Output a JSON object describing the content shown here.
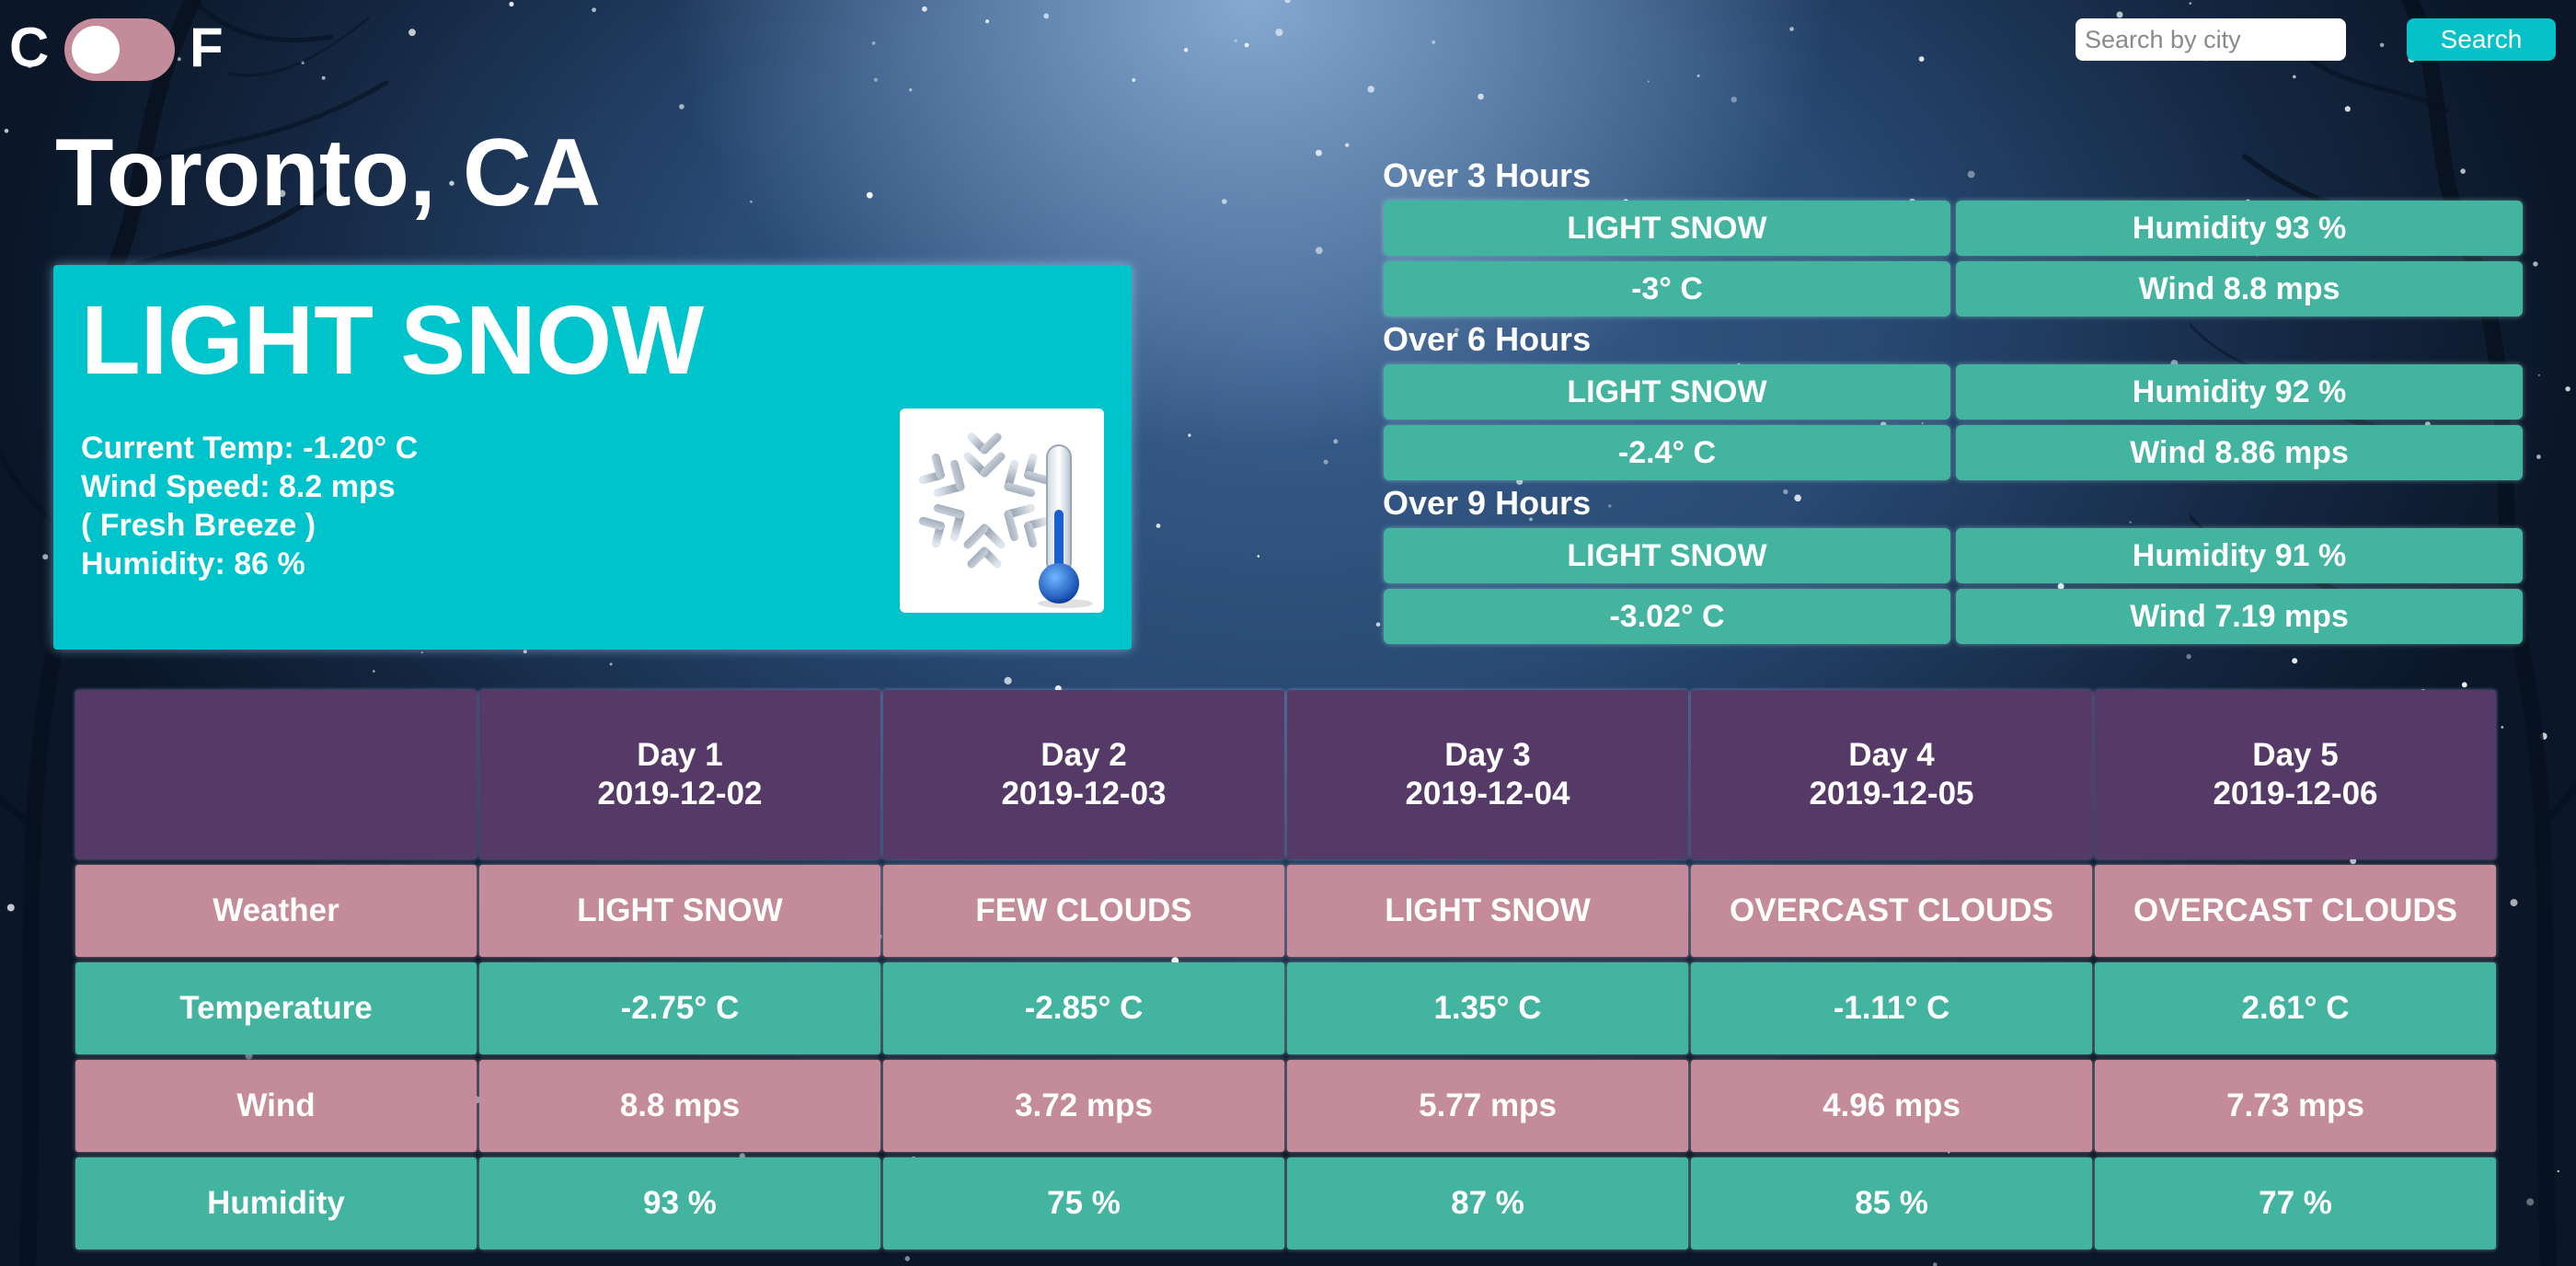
{
  "units": {
    "celsius": "C",
    "fahrenheit": "F"
  },
  "search": {
    "placeholder": "Search by city",
    "button_label": "Search",
    "value": ""
  },
  "city": "Toronto, CA",
  "current": {
    "description": "LIGHT SNOW",
    "temp": "Current Temp: -1.20° C",
    "wind": "Wind Speed: 8.2 mps",
    "wind_desc": "( Fresh Breeze )",
    "humidity": "Humidity: 86 %",
    "icon": "snowflake-thermometer-icon"
  },
  "hourly": [
    {
      "title": "Over 3 Hours",
      "description": "LIGHT SNOW",
      "humidity": "Humidity 93 %",
      "temp": "-3° C",
      "wind": "Wind 8.8 mps"
    },
    {
      "title": "Over 6 Hours",
      "description": "LIGHT SNOW",
      "humidity": "Humidity 92 %",
      "temp": "-2.4° C",
      "wind": "Wind 8.86 mps"
    },
    {
      "title": "Over 9 Hours",
      "description": "LIGHT SNOW",
      "humidity": "Humidity 91 %",
      "temp": "-3.02° C",
      "wind": "Wind 7.19 mps"
    }
  ],
  "forecast": {
    "days": [
      {
        "label": "Day 1",
        "date": "2019-12-02"
      },
      {
        "label": "Day 2",
        "date": "2019-12-03"
      },
      {
        "label": "Day 3",
        "date": "2019-12-04"
      },
      {
        "label": "Day 4",
        "date": "2019-12-05"
      },
      {
        "label": "Day 5",
        "date": "2019-12-06"
      }
    ],
    "rows": [
      {
        "label": "Weather",
        "values": [
          "LIGHT SNOW",
          "FEW CLOUDS",
          "LIGHT SNOW",
          "OVERCAST CLOUDS",
          "OVERCAST CLOUDS"
        ]
      },
      {
        "label": "Temperature",
        "values": [
          "-2.75° C",
          "-2.85° C",
          "1.35° C",
          "-1.11° C",
          "2.61° C"
        ]
      },
      {
        "label": "Wind",
        "values": [
          "8.8 mps",
          "3.72 mps",
          "5.77 mps",
          "4.96 mps",
          "7.73 mps"
        ]
      },
      {
        "label": "Humidity",
        "values": [
          "93 %",
          "75 %",
          "87 %",
          "85 %",
          "77 %"
        ]
      }
    ]
  },
  "colors": {
    "teal": "#42b49f",
    "cyan": "#00c4cc",
    "pink": "#c48b9a",
    "purple": "#553a67",
    "search_button": "#05c2c9"
  }
}
